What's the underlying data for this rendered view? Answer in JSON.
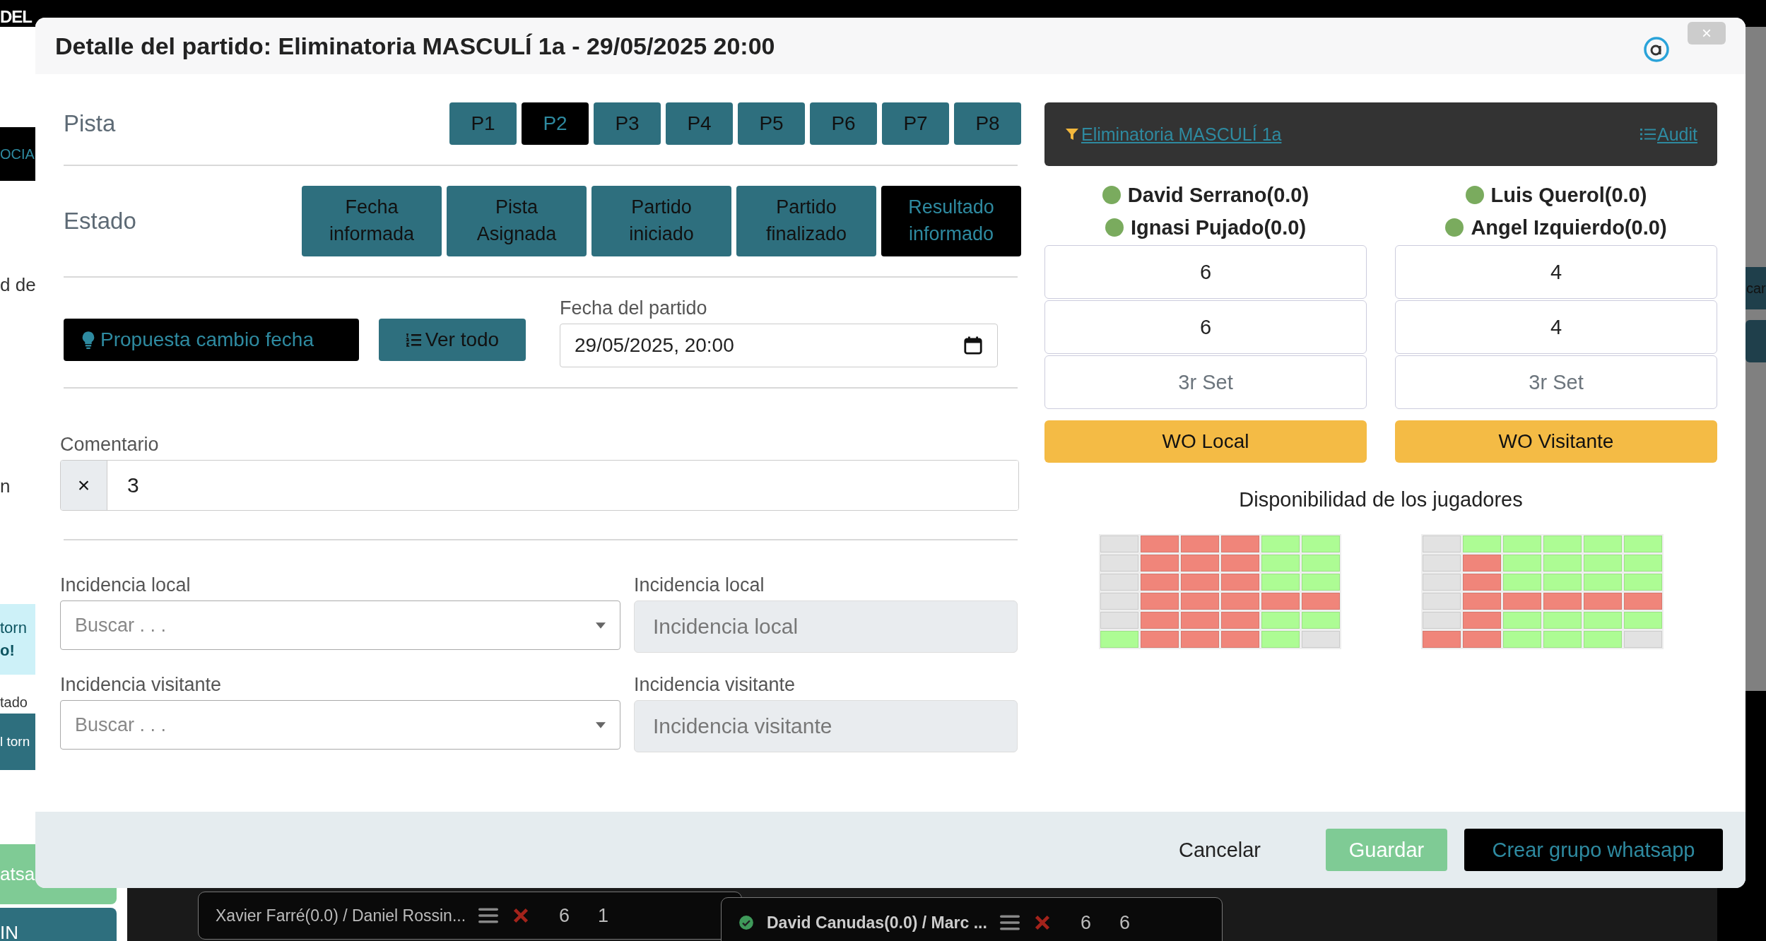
{
  "background": {
    "brand": "DEL",
    "left_fragments": [
      {
        "kind": "dark",
        "text": "OCIA"
      },
      {
        "kind": "plain",
        "text": "d de"
      },
      {
        "kind": "plain",
        "text": "n"
      },
      {
        "kind": "info",
        "text": "torn",
        "bold_text": "o!"
      },
      {
        "kind": "plain",
        "text": "tado"
      },
      {
        "kind": "teal",
        "text": "l torn"
      },
      {
        "kind": "green",
        "text": "atsa"
      },
      {
        "kind": "teal",
        "text": "IN"
      }
    ],
    "right_fragment": "car",
    "match_cards": [
      {
        "players": "Xavier Farré(0.0) / Daniel Rossin...",
        "confirmed": false,
        "score_1": "6",
        "score_2": "1"
      },
      {
        "players": "David Canudas(0.0) / Marc ...",
        "confirmed": true,
        "score_1": "6",
        "score_2": "6"
      }
    ]
  },
  "modal": {
    "title": "Detalle del partido: Eliminatoria MASCULÍ 1a - 29/05/2025 20:00",
    "close": "×"
  },
  "pista": {
    "label": "Pista",
    "courts": [
      {
        "label": "P1",
        "selected": false
      },
      {
        "label": "P2",
        "selected": true
      },
      {
        "label": "P3",
        "selected": false
      },
      {
        "label": "P4",
        "selected": false
      },
      {
        "label": "P5",
        "selected": false
      },
      {
        "label": "P6",
        "selected": false
      },
      {
        "label": "P7",
        "selected": false
      },
      {
        "label": "P8",
        "selected": false
      }
    ]
  },
  "estado": {
    "label": "Estado",
    "states": [
      {
        "label": "Fecha informada",
        "selected": false
      },
      {
        "label": "Pista Asignada",
        "selected": false
      },
      {
        "label": "Partido iniciado",
        "selected": false
      },
      {
        "label": "Partido finalizado",
        "selected": false
      },
      {
        "label": "Resultado informado",
        "selected": true
      }
    ]
  },
  "actions": [
    {
      "kind": "proposal",
      "label": "Propuesta cambio fecha"
    },
    {
      "kind": "all",
      "label": "Ver todo"
    }
  ],
  "date_field": {
    "label": "Fecha del partido",
    "value": "29/05/2025, 20:00"
  },
  "comment": {
    "label": "Comentario",
    "clear": "×",
    "value": "3"
  },
  "incidences": [
    {
      "label": "Incidencia local",
      "placeholder": "Buscar . . .",
      "disabled": false
    },
    {
      "label": "Incidencia local",
      "placeholder": "Incidencia local",
      "disabled": true
    },
    {
      "label": "Incidencia visitante",
      "placeholder": "Buscar . . .",
      "disabled": false
    },
    {
      "label": "Incidencia visitante",
      "placeholder": "Incidencia visitante",
      "disabled": true
    }
  ],
  "match_bar": {
    "tournament_link": "Eliminatoria MASCULÍ 1a",
    "audit_link": "Audit"
  },
  "teams": [
    {
      "players": [
        "David Serrano(0.0)",
        "Ignasi Pujado(0.0)"
      ],
      "sets": [
        {
          "value": "6"
        },
        {
          "value": "6"
        },
        {
          "placeholder": "3r Set"
        }
      ],
      "wo_button": "WO Local"
    },
    {
      "players": [
        "Luis Querol(0.0)",
        "Angel Izquierdo(0.0)"
      ],
      "sets": [
        {
          "value": "4"
        },
        {
          "value": "4"
        },
        {
          "placeholder": "3r Set"
        }
      ],
      "wo_button": "WO Visitante"
    }
  ],
  "availability": {
    "title": "Disponibilidad de los jugadores",
    "grids": [
      [
        [
          {
            "color": "#e2e2e2"
          },
          {
            "color": "#f0857a"
          },
          {
            "color": "#f0857a"
          },
          {
            "color": "#f0857a"
          },
          {
            "color": "#adfc94"
          },
          {
            "color": "#adfc94"
          }
        ],
        [
          {
            "color": "#e2e2e2"
          },
          {
            "color": "#f0857a"
          },
          {
            "color": "#f0857a"
          },
          {
            "color": "#f0857a"
          },
          {
            "color": "#adfc94"
          },
          {
            "color": "#adfc94"
          }
        ],
        [
          {
            "color": "#e2e2e2"
          },
          {
            "color": "#f0857a"
          },
          {
            "color": "#f0857a"
          },
          {
            "color": "#f0857a"
          },
          {
            "color": "#adfc94"
          },
          {
            "color": "#adfc94"
          }
        ],
        [
          {
            "color": "#e2e2e2"
          },
          {
            "color": "#f0857a"
          },
          {
            "color": "#f0857a"
          },
          {
            "color": "#f0857a"
          },
          {
            "color": "#f0857a"
          },
          {
            "color": "#f0857a"
          }
        ],
        [
          {
            "color": "#e2e2e2"
          },
          {
            "color": "#f0857a"
          },
          {
            "color": "#f0857a"
          },
          {
            "color": "#f0857a"
          },
          {
            "color": "#adfc94"
          },
          {
            "color": "#adfc94"
          }
        ],
        [
          {
            "color": "#adfc94"
          },
          {
            "color": "#f0857a"
          },
          {
            "color": "#f0857a"
          },
          {
            "color": "#f0857a"
          },
          {
            "color": "#adfc94"
          },
          {
            "color": "#e2e2e2"
          }
        ]
      ],
      [
        [
          {
            "color": "#e2e2e2"
          },
          {
            "color": "#adfc94"
          },
          {
            "color": "#adfc94"
          },
          {
            "color": "#adfc94"
          },
          {
            "color": "#adfc94"
          },
          {
            "color": "#adfc94"
          }
        ],
        [
          {
            "color": "#e2e2e2"
          },
          {
            "color": "#f0857a"
          },
          {
            "color": "#adfc94"
          },
          {
            "color": "#adfc94"
          },
          {
            "color": "#adfc94"
          },
          {
            "color": "#adfc94"
          }
        ],
        [
          {
            "color": "#e2e2e2"
          },
          {
            "color": "#f0857a"
          },
          {
            "color": "#adfc94"
          },
          {
            "color": "#adfc94"
          },
          {
            "color": "#adfc94"
          },
          {
            "color": "#adfc94"
          }
        ],
        [
          {
            "color": "#e2e2e2"
          },
          {
            "color": "#f0857a"
          },
          {
            "color": "#f0857a"
          },
          {
            "color": "#f0857a"
          },
          {
            "color": "#f0857a"
          },
          {
            "color": "#f0857a"
          }
        ],
        [
          {
            "color": "#e2e2e2"
          },
          {
            "color": "#f0857a"
          },
          {
            "color": "#adfc94"
          },
          {
            "color": "#adfc94"
          },
          {
            "color": "#adfc94"
          },
          {
            "color": "#adfc94"
          }
        ],
        [
          {
            "color": "#f0857a"
          },
          {
            "color": "#f0857a"
          },
          {
            "color": "#adfc94"
          },
          {
            "color": "#adfc94"
          },
          {
            "color": "#adfc94"
          },
          {
            "color": "#e2e2e2"
          }
        ]
      ]
    ]
  },
  "footer": {
    "buttons": [
      {
        "kind": "link",
        "label": "Cancelar"
      },
      {
        "kind": "success",
        "label": "Guardar"
      },
      {
        "kind": "dark",
        "label": "Crear grupo whatsapp"
      }
    ]
  }
}
